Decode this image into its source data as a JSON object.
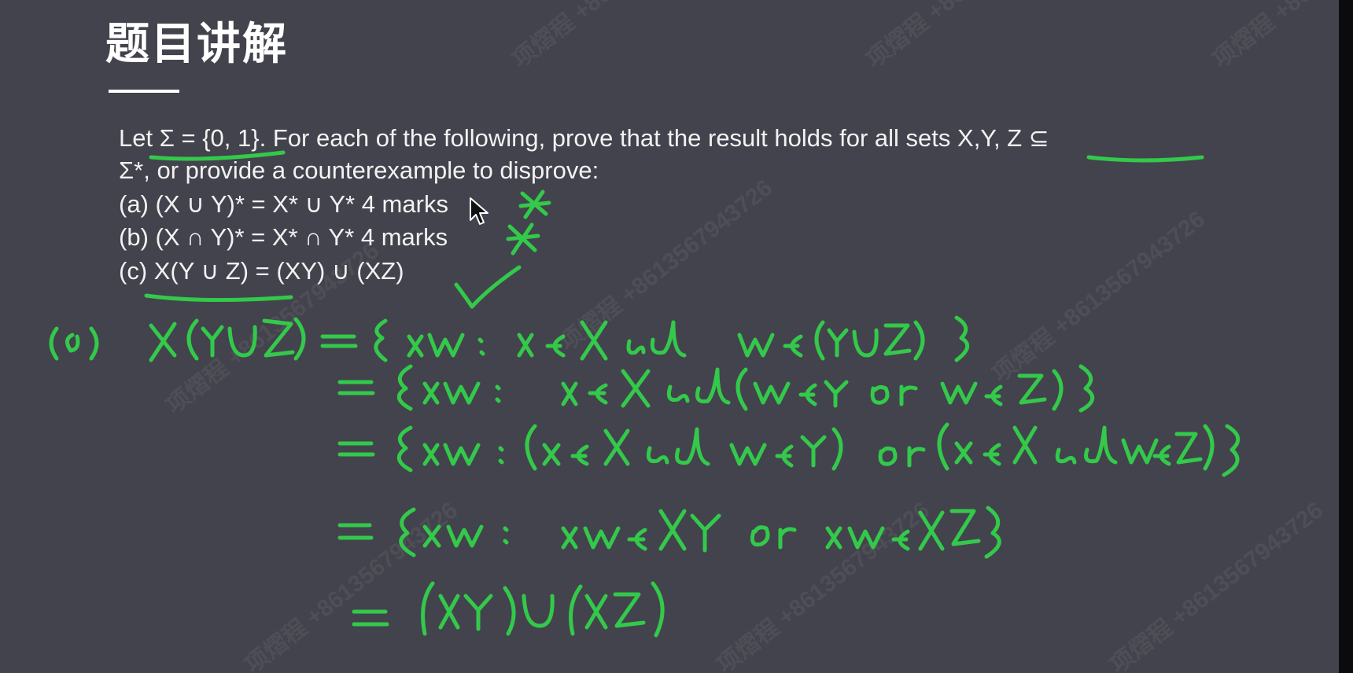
{
  "slide": {
    "title": "题目讲解",
    "question": {
      "line1": "Let Σ = {0, 1}. For each of the following, prove that the result holds for all sets X,Y, Z ⊆",
      "line2": "Σ*, or provide a counterexample to disprove:",
      "part_a": "(a) (X ∪ Y)* = X* ∪ Y* 4 marks",
      "part_b": "(b) (X ∩ Y)* = X* ∩ Y* 4 marks",
      "part_c": "(c) X(Y ∪ Z) = (XY) ∪ (XZ)"
    }
  },
  "handwriting": {
    "color": "#33c94a",
    "mark_a": "✗",
    "mark_b": "✗",
    "mark_c": "✓",
    "label": "(c)",
    "line1": "X(Y∪Z) = {xw : x∈X and w∈(Y∪Z)}",
    "line2": "= {xw : x∈X and (w∈Y or w∈Z)}",
    "line3": "= {xw : (x∈X and w∈Y) or (x∈X and w∈Z)}",
    "line4": "= {xw : xw∈XY or xw∈XZ}",
    "line5": "= (XY)∪(XZ)"
  },
  "watermark": {
    "text": "项熠程 +8613567943726"
  }
}
